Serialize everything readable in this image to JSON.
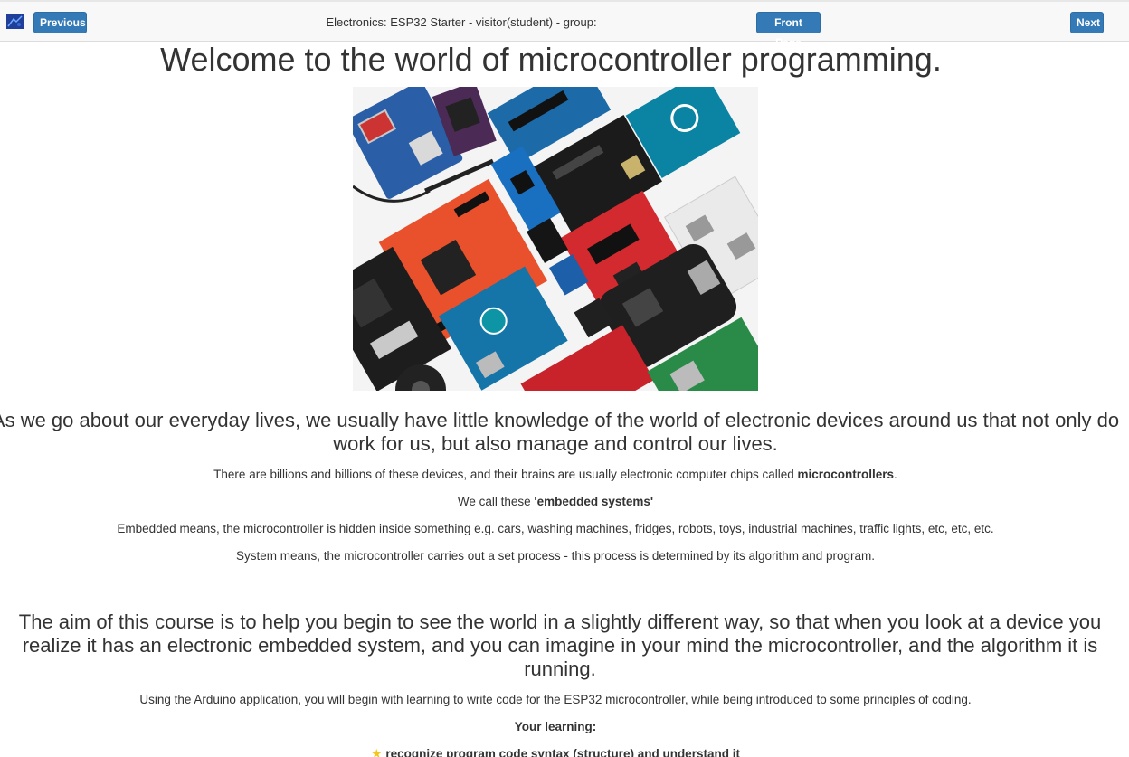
{
  "nav": {
    "previous_label": "Previous",
    "course_title": "Electronics: ESP32 Starter - visitor(student) - group:",
    "front_page_label": "Front Page",
    "next_label": "Next",
    "home_icon": "site-logo-icon"
  },
  "content": {
    "title": "Welcome to the world of microcontroller programming.",
    "hero_image": "microcontroller-boards-photo",
    "lead1": "As we go about our everyday lives, we usually have little knowledge of the world of electronic devices around us that not only do work for us, but also manage and control our lives.",
    "p1_pre": "There are billions and billions of these devices, and their brains are usually electronic computer chips called ",
    "p1_bold": "microcontrollers",
    "p1_post": ".",
    "p2_pre": "We call these ",
    "p2_bold": "'embedded systems'",
    "p3": "Embedded means, the microcontroller is hidden inside something e.g. cars, washing machines, fridges, robots, toys, industrial machines, traffic lights, etc, etc, etc.",
    "p4": "System means, the microcontroller carries out a set process - this process is determined by its algorithm and program.",
    "lead2": "The aim of this course is to help you begin to see the world in a slightly different way, so that when you look at a device you realize it has an electronic embedded system, and you can imagine in your mind the microcontroller, and the algorithm it is running.",
    "p5": "Using the Arduino application, you will begin with learning to write code for the ESP32 microcontroller, while being introduced to some principles of coding.",
    "p6": "Your learning:",
    "p7": "recognize program code syntax (structure) and understand it"
  },
  "colors": {
    "button": "#337ab7",
    "text": "#333333",
    "topbar": "#f8f8f8"
  }
}
